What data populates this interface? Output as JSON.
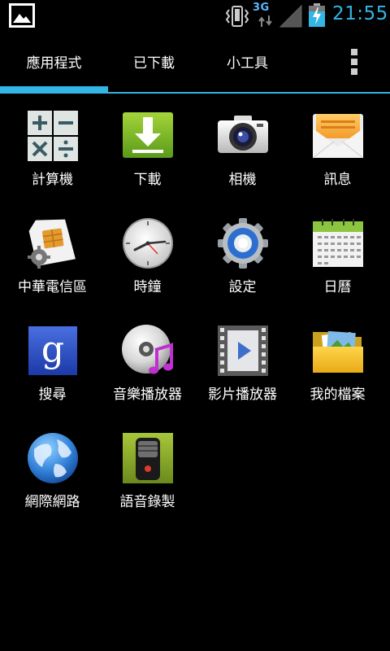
{
  "status_bar": {
    "network": "3G",
    "time": "21:55",
    "icons": [
      "gallery-icon",
      "vibrate-icon",
      "data-arrows-icon",
      "signal-icon",
      "battery-charging-icon"
    ]
  },
  "tabs": [
    {
      "label": "應用程式",
      "selected": true
    },
    {
      "label": "已下載",
      "selected": false
    },
    {
      "label": "小工具",
      "selected": false
    }
  ],
  "accent_color": "#33b5e5",
  "apps": [
    {
      "label": "計算機",
      "icon": "calculator-icon"
    },
    {
      "label": "下載",
      "icon": "download-icon"
    },
    {
      "label": "相機",
      "icon": "camera-icon"
    },
    {
      "label": "訊息",
      "icon": "messaging-icon"
    },
    {
      "label": "中華電信區",
      "icon": "sim-toolkit-icon"
    },
    {
      "label": "時鐘",
      "icon": "clock-icon"
    },
    {
      "label": "設定",
      "icon": "settings-icon"
    },
    {
      "label": "日曆",
      "icon": "calendar-icon"
    },
    {
      "label": "搜尋",
      "icon": "google-search-icon"
    },
    {
      "label": "音樂播放器",
      "icon": "music-player-icon"
    },
    {
      "label": "影片播放器",
      "icon": "video-player-icon"
    },
    {
      "label": "我的檔案",
      "icon": "folder-icon"
    },
    {
      "label": "網際網路",
      "icon": "browser-globe-icon"
    },
    {
      "label": "語音錄製",
      "icon": "voice-recorder-icon"
    }
  ]
}
